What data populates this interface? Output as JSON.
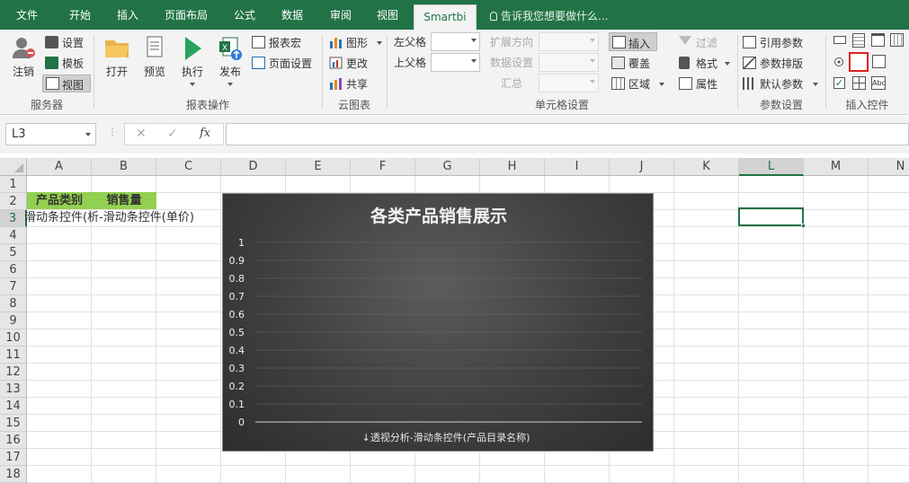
{
  "tabs": [
    {
      "label": "文件",
      "name": "tab-file"
    },
    {
      "label": "开始",
      "name": "tab-home"
    },
    {
      "label": "插入",
      "name": "tab-insert"
    },
    {
      "label": "页面布局",
      "name": "tab-page-layout"
    },
    {
      "label": "公式",
      "name": "tab-formulas"
    },
    {
      "label": "数据",
      "name": "tab-data"
    },
    {
      "label": "审阅",
      "name": "tab-review"
    },
    {
      "label": "视图",
      "name": "tab-view"
    },
    {
      "label": "Smartbi",
      "name": "tab-smartbi"
    }
  ],
  "tellme": "告诉我您想要做什么...",
  "ribbon": {
    "server": {
      "logout": "注销",
      "settings": "设置",
      "template": "模板",
      "view": "视图",
      "group": "服务器"
    },
    "report": {
      "open": "打开",
      "preview": "预览",
      "execute": "执行",
      "publish": "发布",
      "macro": "报表宏",
      "page_setup": "页面设置",
      "group": "报表操作"
    },
    "cloud": {
      "shape": "图形",
      "change": "更改",
      "share": "共享",
      "group": "云图表"
    },
    "cell": {
      "left_parent": "左父格",
      "up_parent": "上父格",
      "expand_dir": "扩展方向",
      "data_setting": "数据设置",
      "summary": "汇总",
      "insert": "插入",
      "overwrite": "覆盖",
      "region": "区域",
      "group": "单元格设置"
    },
    "style": {
      "filter": "过滤",
      "format": "格式",
      "property": "属性"
    },
    "param": {
      "ref": "引用参数",
      "layout": "参数排版",
      "default": "默认参数",
      "group": "参数设置"
    },
    "controls": {
      "group": "插入控件"
    }
  },
  "formula": {
    "cell_ref": "L3",
    "cancel": "✕",
    "confirm": "✓",
    "fx": "fx",
    "value": ""
  },
  "columns": [
    "A",
    "B",
    "C",
    "D",
    "E",
    "F",
    "G",
    "H",
    "I",
    "J",
    "K",
    "L",
    "M",
    "N"
  ],
  "rows": [
    "1",
    "2",
    "3",
    "4",
    "5",
    "6",
    "7",
    "8",
    "9",
    "10",
    "11",
    "12",
    "13",
    "14",
    "15",
    "16",
    "17",
    "18"
  ],
  "cells": {
    "A2": "产品类别",
    "B2": "销售量",
    "A3": "滑动条控件(析-滑动条控件(单价)"
  },
  "colors": {
    "accent": "#217346",
    "header_fill": "#92d050",
    "selection": "#217346"
  },
  "chart_data": {
    "type": "bar",
    "title": "各类产品销售展示",
    "xlabel": "↓透视分析-滑动条控件(产品目录名称)",
    "ylabel": "",
    "ylim": [
      0,
      1
    ],
    "yticks": [
      "1",
      "0.9",
      "0.8",
      "0.7",
      "0.6",
      "0.5",
      "0.4",
      "0.3",
      "0.2",
      "0.1",
      "0"
    ],
    "categories": [],
    "values": []
  }
}
